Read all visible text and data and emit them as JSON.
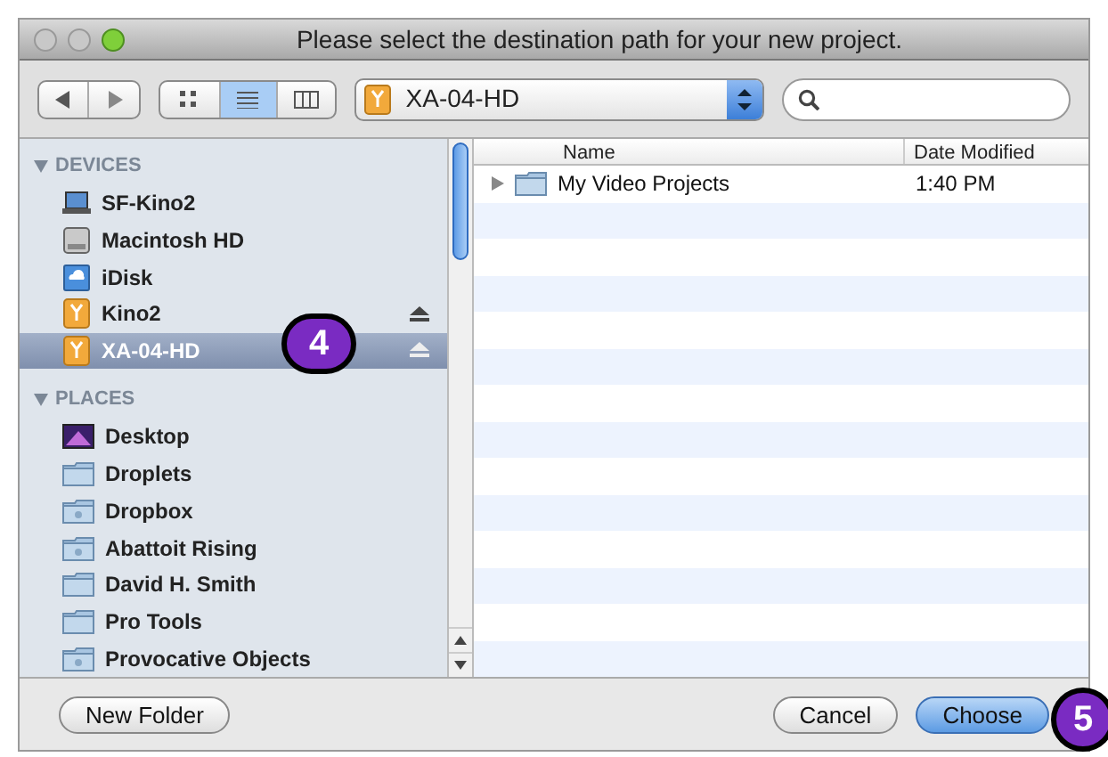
{
  "window": {
    "title": "Please select the destination path for your new project."
  },
  "toolbar": {
    "view_modes": [
      {
        "kind": "icons",
        "selected": false
      },
      {
        "kind": "list",
        "selected": true
      },
      {
        "kind": "columns",
        "selected": false
      }
    ],
    "location": {
      "label": "XA-04-HD"
    }
  },
  "sidebar": {
    "sections": [
      {
        "title": "DEVICES",
        "items": [
          {
            "label": "SF-Kino2",
            "kind": "computer",
            "selected": false,
            "ejectable": false
          },
          {
            "label": "Macintosh HD",
            "kind": "disk",
            "selected": false,
            "ejectable": false
          },
          {
            "label": "iDisk",
            "kind": "idisk",
            "selected": false,
            "ejectable": false
          },
          {
            "label": "Kino2",
            "kind": "drive",
            "selected": false,
            "ejectable": true
          },
          {
            "label": "XA-04-HD",
            "kind": "drive",
            "selected": true,
            "ejectable": true
          }
        ]
      },
      {
        "title": "PLACES",
        "items": [
          {
            "label": "Desktop",
            "kind": "desktop",
            "selected": false,
            "ejectable": false
          },
          {
            "label": "Droplets",
            "kind": "folder",
            "selected": false,
            "ejectable": false
          },
          {
            "label": "Dropbox",
            "kind": "folder-special",
            "selected": false,
            "ejectable": false
          },
          {
            "label": "Abattoit Rising",
            "kind": "folder-special",
            "selected": false,
            "ejectable": false
          },
          {
            "label": "David H. Smith",
            "kind": "folder",
            "selected": false,
            "ejectable": false
          },
          {
            "label": "Pro Tools",
            "kind": "folder",
            "selected": false,
            "ejectable": false
          },
          {
            "label": "Provocative Objects",
            "kind": "folder-special",
            "selected": false,
            "ejectable": false
          }
        ]
      }
    ]
  },
  "file_list": {
    "columns": [
      "Name",
      "Date Modified"
    ],
    "rows": [
      {
        "name": "My Video Projects",
        "date_modified": "1:40 PM"
      }
    ]
  },
  "buttons": [
    {
      "label": "New Folder",
      "kind": "plain"
    },
    {
      "label": "Cancel",
      "kind": "plain"
    },
    {
      "label": "Choose",
      "kind": "default"
    }
  ],
  "callouts": [
    "4",
    "5"
  ]
}
